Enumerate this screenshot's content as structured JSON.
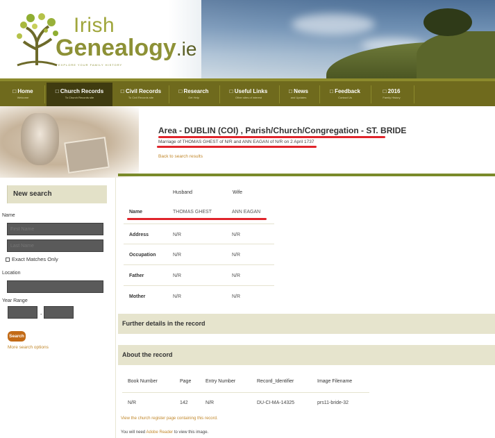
{
  "site": {
    "logo_word1": "Irish",
    "logo_word2": "Genealogy",
    "logo_tld": ".ie",
    "logo_tagline": "EXPLORE YOUR FAMILY HISTORY"
  },
  "nav": {
    "items": [
      {
        "label": "Home",
        "sub": "Welcome"
      },
      {
        "label": "Church Records",
        "sub": "To Church Records site"
      },
      {
        "label": "Civil Records",
        "sub": "To Civil Records site"
      },
      {
        "label": "Research",
        "sub": "Get Help"
      },
      {
        "label": "Useful Links",
        "sub": "Other sites of interest"
      },
      {
        "label": "News",
        "sub": "and Updates"
      },
      {
        "label": "Feedback",
        "sub": "Contact Us"
      },
      {
        "label": "2016",
        "sub": "Family History"
      }
    ]
  },
  "record_header": {
    "area_title": "Area - DUBLIN (COI) , Parish/Church/Congregation - ST. BRIDE",
    "marriage_line": "Marriage of THOMAS GHEST of N/R and ANN EAGAN of N/R on 2 April 1737",
    "back_link": "Back to search results"
  },
  "sidebar": {
    "title": "New search",
    "name_label": "Name",
    "first_name_placeholder": "First Name",
    "last_name_placeholder": "Last Name",
    "exact_matches_label": "Exact Matches Only",
    "location_label": "Location",
    "year_range_label": "Year Range",
    "year_separator": "-",
    "search_button": "Search",
    "more_options_link": "More search options"
  },
  "record_table": {
    "col_husband": "Husband",
    "col_wife": "Wife",
    "rows": [
      {
        "label": "Name",
        "husband": "THOMAS GHEST",
        "wife": "ANN EAGAN"
      },
      {
        "label": "Address",
        "husband": "N/R",
        "wife": "N/R"
      },
      {
        "label": "Occupation",
        "husband": "N/R",
        "wife": "N/R"
      },
      {
        "label": "Father",
        "husband": "N/R",
        "wife": "N/R"
      },
      {
        "label": "Mother",
        "husband": "N/R",
        "wife": "N/R"
      }
    ]
  },
  "sections": {
    "further_details": "Further details in the record",
    "about_record": "About the record"
  },
  "about_table": {
    "headers": [
      "Book Number",
      "Page",
      "Entry Number",
      "Record_Identifier",
      "Image Filename"
    ],
    "values": [
      "N/R",
      "142",
      "N/R",
      "DU-CI-MA-14325",
      "prs11-bride-32"
    ]
  },
  "footer": {
    "register_link": "View the church register page containing this record.",
    "adobe_prefix": "You will need",
    "adobe_link": "Adobe Reader",
    "adobe_suffix": "to view this image."
  },
  "colors": {
    "nav_bg": "#6f6a1d",
    "nav_active": "#3f3b10",
    "underline_red": "#e0242b",
    "link_orange": "#c1872a",
    "search_button": "#c26a16",
    "section_bg": "#e6e4cd"
  }
}
